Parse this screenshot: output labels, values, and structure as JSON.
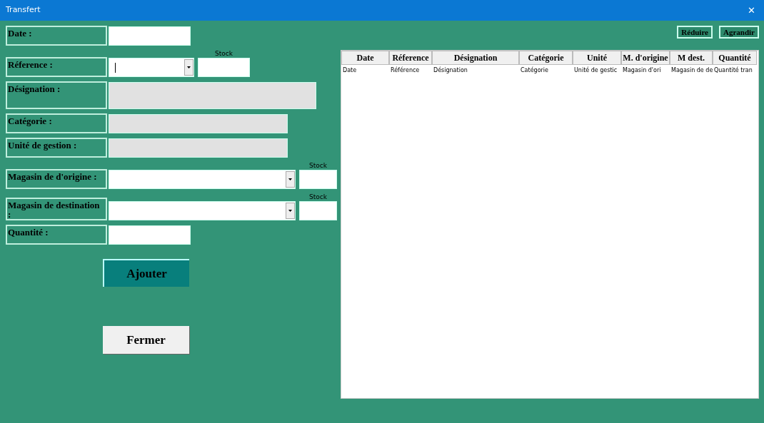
{
  "window": {
    "title": "Transfert",
    "close": "✕"
  },
  "form": {
    "fields": [
      {
        "label": "Date :",
        "kind": "text",
        "disabled": false
      },
      {
        "label": "Réference :",
        "kind": "combo",
        "disabled": false,
        "stock": "Stock"
      },
      {
        "label": "Désignation :",
        "kind": "tall",
        "disabled": true
      },
      {
        "label": "Catégorie :",
        "kind": "text",
        "disabled": true
      },
      {
        "label": "Unité de gestion :",
        "kind": "text",
        "disabled": true
      },
      {
        "label": "Magasin de d'origine :",
        "kind": "combo",
        "disabled": false,
        "stock": "Stock"
      },
      {
        "label": "Magasin de destination :",
        "kind": "combo",
        "disabled": false,
        "stock": "Stock"
      },
      {
        "label": "Quantité :",
        "kind": "text",
        "disabled": false
      }
    ],
    "buttons": [
      {
        "label": "Ajouter",
        "kind": "primary"
      },
      {
        "label": "Fermer",
        "kind": "secondary"
      }
    ]
  },
  "zoom_buttons": [
    "Réduire",
    "Agrandir"
  ],
  "table": {
    "columns": [
      "Date",
      "Réference",
      "Désignation",
      "Catégorie",
      "Unité",
      "M. d'origine",
      "M dest.",
      "Quantité"
    ],
    "rows": [
      [
        "Date",
        "Référence",
        "Désignation",
        "Catégorie",
        "Unité de gestic",
        "Magasin d'ori",
        "Magasin de de",
        "Quantité tran"
      ]
    ]
  }
}
